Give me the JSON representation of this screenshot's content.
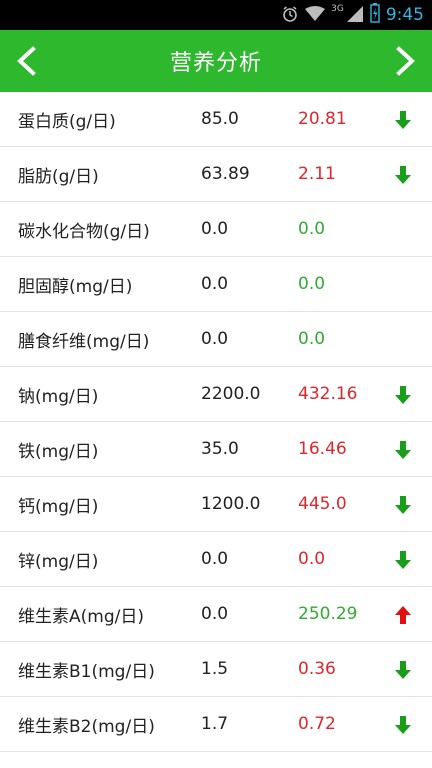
{
  "status_bar": {
    "alarm_icon": "alarm-icon",
    "wifi_icon": "wifi-icon",
    "network_label": "3G",
    "signal_icon": "signal-icon",
    "battery_icon": "battery-charging-icon",
    "time": "9:45"
  },
  "header": {
    "title": "营养分析",
    "prev_icon": "chevron-left-icon",
    "next_icon": "chevron-right-icon"
  },
  "colors": {
    "accent": "#2db82d",
    "over_limit": "#e0262d",
    "ok": "#33aa33",
    "down_arrow": "#1a9e1a",
    "up_arrow": "#e01010"
  },
  "nutrients": [
    {
      "name": "蛋白质(g/日)",
      "standard": "85.0",
      "value": "20.81",
      "status": "red",
      "trend": "down"
    },
    {
      "name": "脂肪(g/日)",
      "standard": "63.89",
      "value": "2.11",
      "status": "red",
      "trend": "down"
    },
    {
      "name": "碳水化合物(g/日)",
      "standard": "0.0",
      "value": "0.0",
      "status": "green",
      "trend": "none"
    },
    {
      "name": "胆固醇(mg/日)",
      "standard": "0.0",
      "value": "0.0",
      "status": "green",
      "trend": "none"
    },
    {
      "name": "膳食纤维(mg/日)",
      "standard": "0.0",
      "value": "0.0",
      "status": "green",
      "trend": "none"
    },
    {
      "name": "钠(mg/日)",
      "standard": "2200.0",
      "value": "432.16",
      "status": "red",
      "trend": "down"
    },
    {
      "name": "铁(mg/日)",
      "standard": "35.0",
      "value": "16.46",
      "status": "red",
      "trend": "down"
    },
    {
      "name": "钙(mg/日)",
      "standard": "1200.0",
      "value": "445.0",
      "status": "red",
      "trend": "down"
    },
    {
      "name": "锌(mg/日)",
      "standard": "0.0",
      "value": "0.0",
      "status": "red",
      "trend": "down"
    },
    {
      "name": "维生素A(mg/日)",
      "standard": "0.0",
      "value": "250.29",
      "status": "green",
      "trend": "up"
    },
    {
      "name": "维生素B1(mg/日)",
      "standard": "1.5",
      "value": "0.36",
      "status": "red",
      "trend": "down"
    },
    {
      "name": "维生素B2(mg/日)",
      "standard": "1.7",
      "value": "0.72",
      "status": "red",
      "trend": "down"
    }
  ]
}
